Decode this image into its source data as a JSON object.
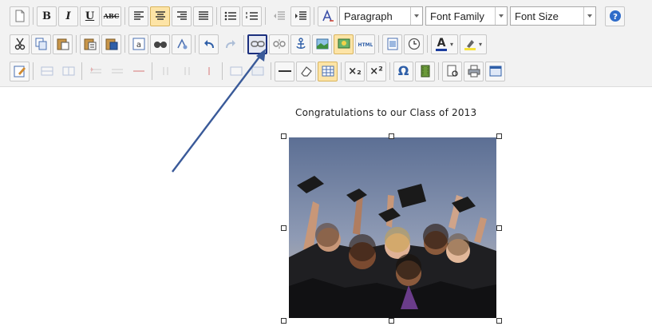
{
  "toolbar": {
    "row1": {
      "format_select": "Paragraph",
      "font_family_select": "Font Family",
      "font_size_select": "Font Size",
      "bold_label": "B",
      "italic_label": "I",
      "underline_label": "U",
      "strike_label": "ABC"
    },
    "row2": {
      "text_color_label": "A"
    },
    "row3": {
      "subscript_label": "×₂",
      "superscript_label": "×²",
      "special_char_label": "Ω"
    }
  },
  "content": {
    "caption": "Congratulations to our Class of 2013"
  },
  "colors": {
    "toolbar_bg": "#f2f2f2",
    "highlight_border": "#1b2f7e",
    "arrow_color": "#3a5a99",
    "active_bg": "#fde4a6"
  },
  "icons": [
    "new-document-icon",
    "align-left-icon",
    "align-center-icon",
    "align-right-icon",
    "justify-icon",
    "bullet-list-icon",
    "numbered-list-icon",
    "outdent-icon",
    "indent-icon",
    "styles-icon",
    "help-icon",
    "cut-icon",
    "copy-icon",
    "paste-icon",
    "paste-text-icon",
    "paste-word-icon",
    "select-all-icon",
    "find-icon",
    "replace-icon",
    "undo-icon",
    "redo-icon",
    "link-icon",
    "unlink-icon",
    "anchor-icon",
    "image-icon",
    "insert-image-icon",
    "html-icon",
    "preview-icon",
    "clock-icon",
    "text-color-icon",
    "highlight-icon",
    "edit-icon",
    "table-icons",
    "horizontal-rule-icon",
    "eraser-icon",
    "grid-icon",
    "media-icon",
    "print-icon",
    "fullscreen-icon"
  ]
}
